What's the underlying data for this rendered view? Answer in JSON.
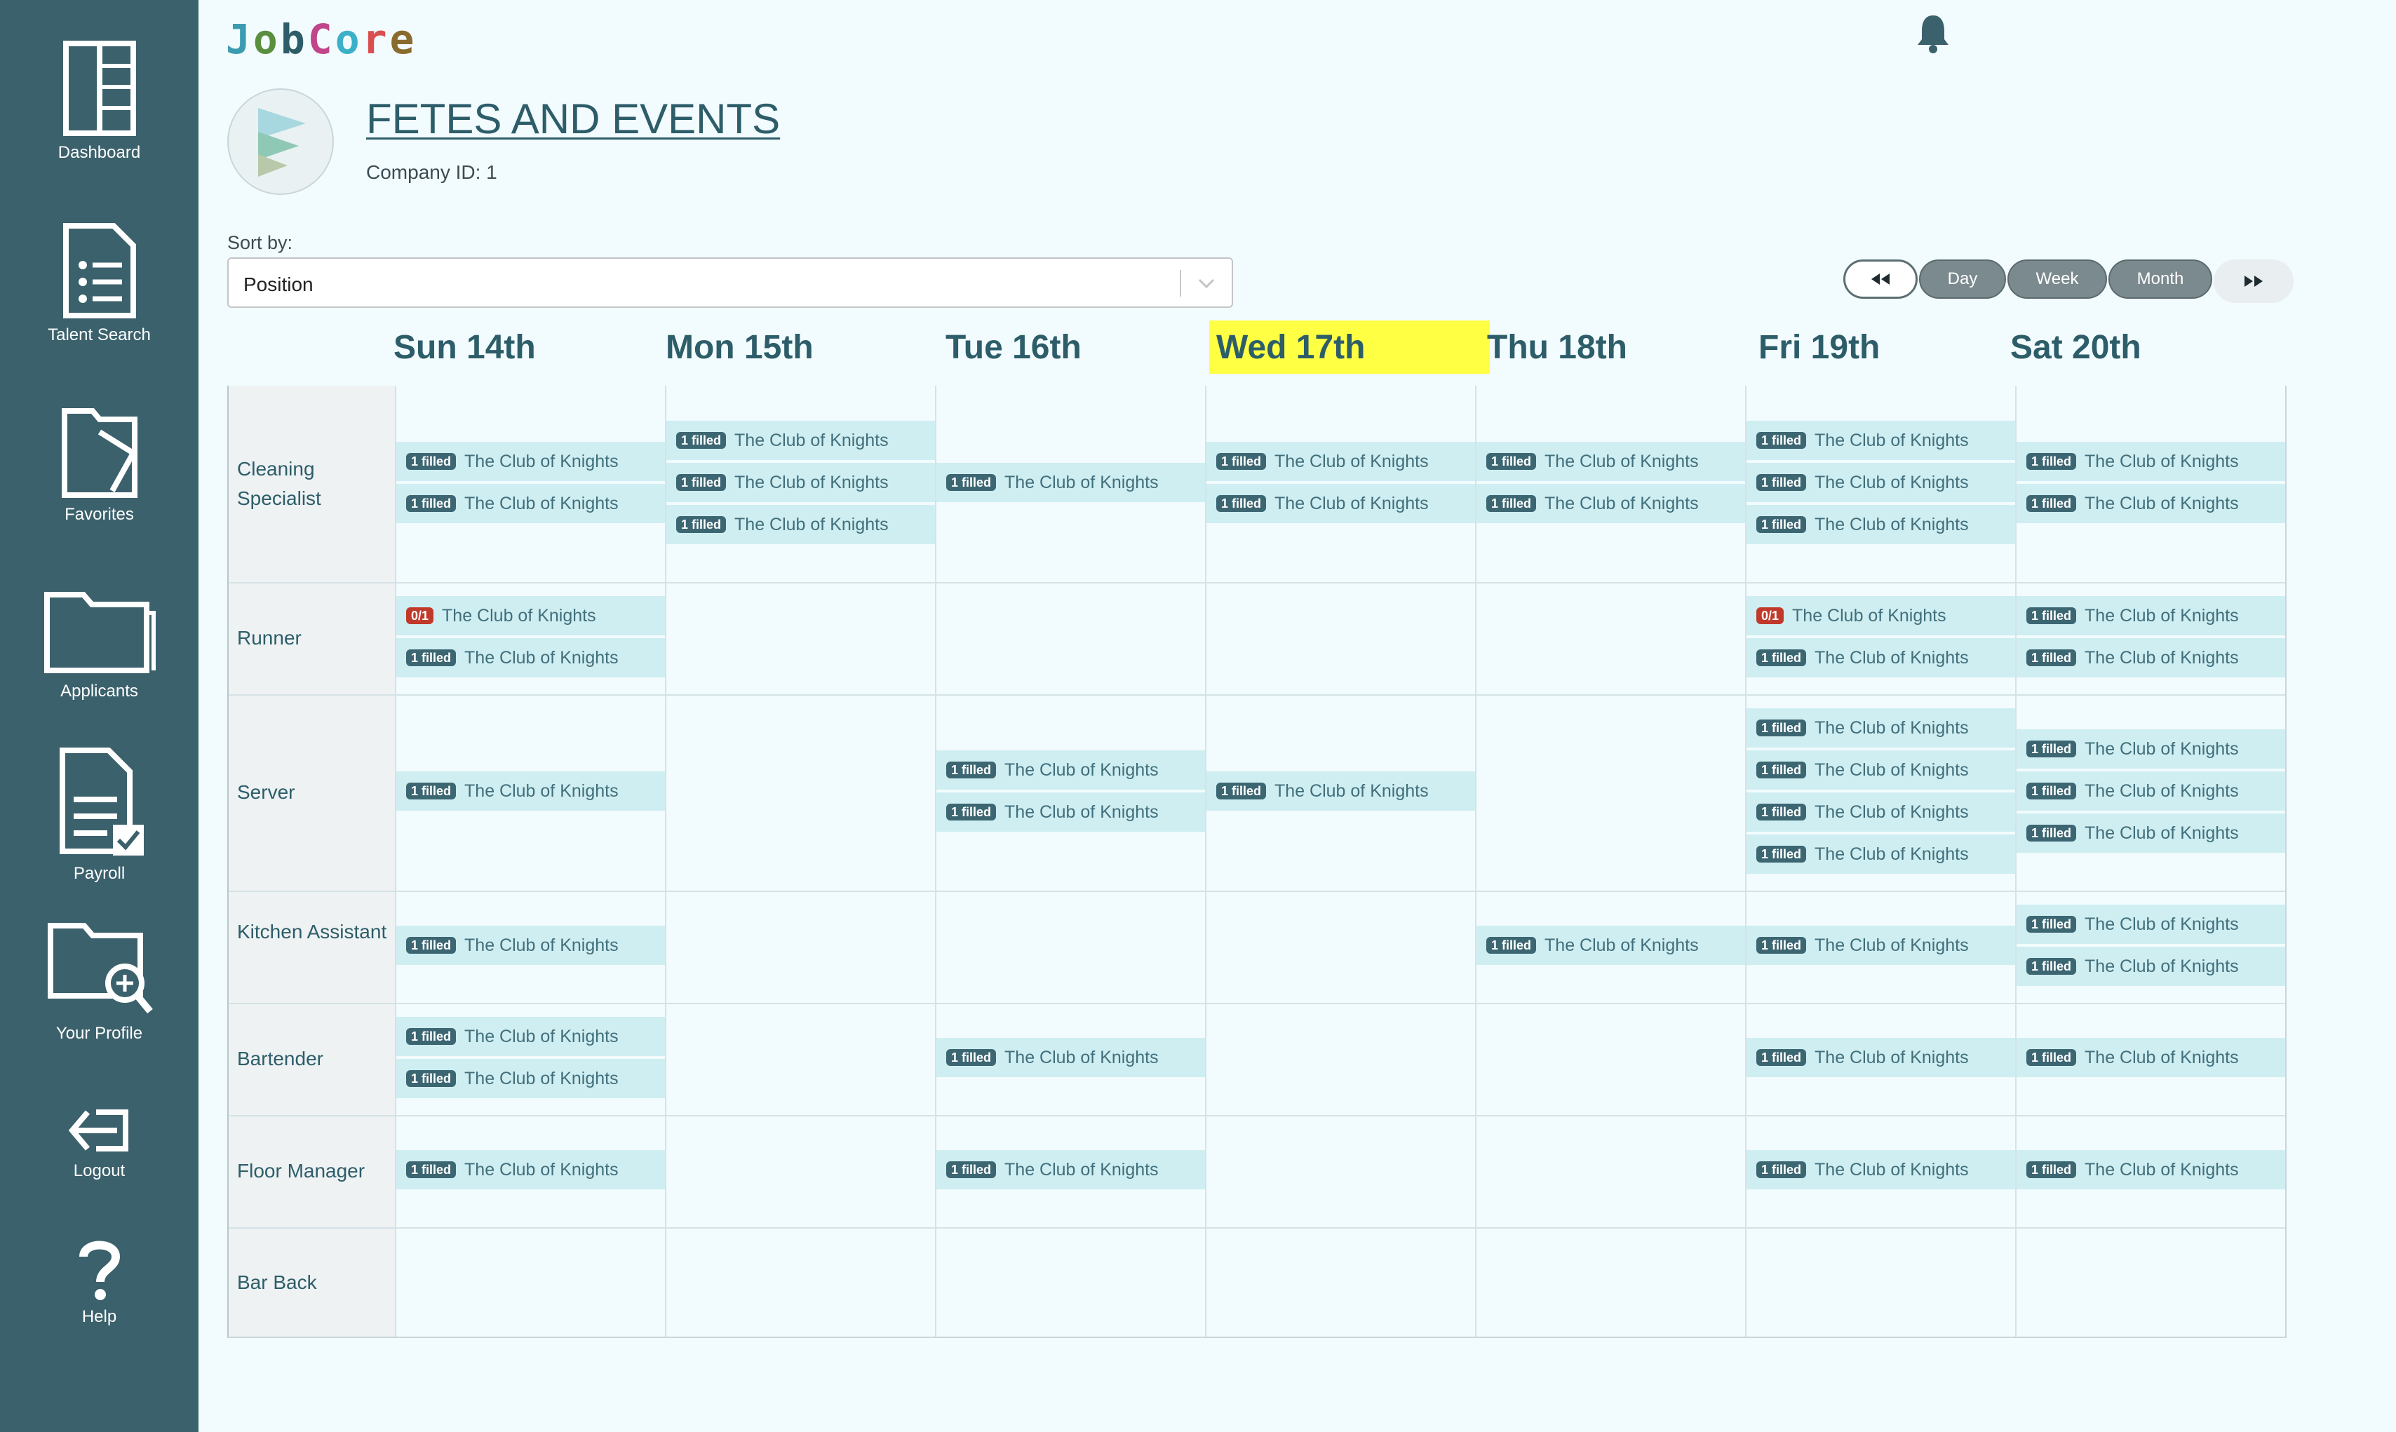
{
  "sidebar": {
    "items": [
      {
        "label": "Dashboard",
        "icon": "dashboard-icon"
      },
      {
        "label": "Talent Search",
        "icon": "document-list-icon"
      },
      {
        "label": "Favorites",
        "icon": "favorites-folder-icon"
      },
      {
        "label": "Applicants",
        "icon": "folder-icon"
      },
      {
        "label": "Payroll",
        "icon": "payroll-document-icon"
      },
      {
        "label": "Your Profile",
        "icon": "folder-search-icon"
      },
      {
        "label": "Logout",
        "icon": "logout-arrow-icon"
      },
      {
        "label": "Help",
        "icon": "question-mark-icon"
      }
    ]
  },
  "header": {
    "brand": "JobCore",
    "notification_icon": "bell-icon"
  },
  "company": {
    "name": "FETES AND EVENTS",
    "id_text": "Company ID: 1"
  },
  "sort": {
    "label": "Sort by:",
    "value": "Position"
  },
  "calendar_nav": {
    "prev_icon": "rewind-icon",
    "next_icon": "fast-forward-icon",
    "views": [
      "Day",
      "Week",
      "Month"
    ]
  },
  "calendar": {
    "today_color": "#ffff44",
    "days": [
      {
        "label": "Sun 14th"
      },
      {
        "label": "Mon 15th"
      },
      {
        "label": "Tue 16th"
      },
      {
        "label": "Wed 17th",
        "today": true
      },
      {
        "label": "Thu 18th"
      },
      {
        "label": "Fri 19th"
      },
      {
        "label": "Sat 20th"
      }
    ],
    "positions": [
      {
        "label": "Cleaning Specialist",
        "shifts": [
          [
            {
              "badge": "1 filled",
              "title": "The Club of Knights"
            },
            {
              "badge": "1 filled",
              "title": "The Club of Knights"
            }
          ],
          [
            {
              "badge": "1 filled",
              "title": "The Club of Knights"
            },
            {
              "badge": "1 filled",
              "title": "The Club of Knights"
            },
            {
              "badge": "1 filled",
              "title": "The Club of Knights"
            }
          ],
          [
            {
              "badge": "1 filled",
              "title": "The Club of Knights"
            }
          ],
          [
            {
              "badge": "1 filled",
              "title": "The Club of Knights"
            },
            {
              "badge": "1 filled",
              "title": "The Club of Knights"
            }
          ],
          [
            {
              "badge": "1 filled",
              "title": "The Club of Knights"
            },
            {
              "badge": "1 filled",
              "title": "The Club of Knights"
            }
          ],
          [
            {
              "badge": "1 filled",
              "title": "The Club of Knights"
            },
            {
              "badge": "1 filled",
              "title": "The Club of Knights"
            },
            {
              "badge": "1 filled",
              "title": "The Club of Knights"
            }
          ],
          [
            {
              "badge": "1 filled",
              "title": "The Club of Knights"
            },
            {
              "badge": "1 filled",
              "title": "The Club of Knights"
            }
          ]
        ]
      },
      {
        "label": "Runner",
        "shifts": [
          [
            {
              "badge": "0/1",
              "title": "The Club of Knights",
              "warn": true
            },
            {
              "badge": "1 filled",
              "title": "The Club of Knights"
            }
          ],
          [],
          [],
          [],
          [],
          [
            {
              "badge": "0/1",
              "title": "The Club of Knights",
              "warn": true
            },
            {
              "badge": "1 filled",
              "title": "The Club of Knights"
            }
          ],
          [
            {
              "badge": "1 filled",
              "title": "The Club of Knights"
            },
            {
              "badge": "1 filled",
              "title": "The Club of Knights"
            }
          ]
        ]
      },
      {
        "label": "Server",
        "shifts": [
          [
            {
              "badge": "1 filled",
              "title": "The Club of Knights"
            }
          ],
          [],
          [
            {
              "badge": "1 filled",
              "title": "The Club of Knights"
            },
            {
              "badge": "1 filled",
              "title": "The Club of Knights"
            }
          ],
          [
            {
              "badge": "1 filled",
              "title": "The Club of Knights"
            }
          ],
          [],
          [
            {
              "badge": "1 filled",
              "title": "The Club of Knights"
            },
            {
              "badge": "1 filled",
              "title": "The Club of Knights"
            },
            {
              "badge": "1 filled",
              "title": "The Club of Knights"
            },
            {
              "badge": "1 filled",
              "title": "The Club of Knights"
            }
          ],
          [
            {
              "badge": "1 filled",
              "title": "The Club of Knights"
            },
            {
              "badge": "1 filled",
              "title": "The Club of Knights"
            },
            {
              "badge": "1 filled",
              "title": "The Club of Knights"
            }
          ]
        ]
      },
      {
        "label": "Kitchen Assistant",
        "shifts": [
          [
            {
              "badge": "1 filled",
              "title": "The Club of Knights"
            }
          ],
          [],
          [],
          [],
          [
            {
              "badge": "1 filled",
              "title": "The Club of Knights"
            }
          ],
          [
            {
              "badge": "1 filled",
              "title": "The Club of Knights"
            }
          ],
          [
            {
              "badge": "1 filled",
              "title": "The Club of Knights"
            },
            {
              "badge": "1 filled",
              "title": "The Club of Knights"
            }
          ]
        ]
      },
      {
        "label": "Bartender",
        "shifts": [
          [
            {
              "badge": "1 filled",
              "title": "The Club of Knights"
            },
            {
              "badge": "1 filled",
              "title": "The Club of Knights"
            }
          ],
          [],
          [
            {
              "badge": "1 filled",
              "title": "The Club of Knights"
            }
          ],
          [],
          [],
          [
            {
              "badge": "1 filled",
              "title": "The Club of Knights"
            }
          ],
          [
            {
              "badge": "1 filled",
              "title": "The Club of Knights"
            }
          ]
        ]
      },
      {
        "label": "Floor Manager",
        "shifts": [
          [
            {
              "badge": "1 filled",
              "title": "The Club of Knights"
            }
          ],
          [],
          [
            {
              "badge": "1 filled",
              "title": "The Club of Knights"
            }
          ],
          [],
          [],
          [
            {
              "badge": "1 filled",
              "title": "The Club of Knights"
            }
          ],
          [
            {
              "badge": "1 filled",
              "title": "The Club of Knights"
            }
          ]
        ]
      },
      {
        "label": "Bar Back",
        "shifts": [
          [],
          [],
          [],
          [],
          [],
          [],
          []
        ]
      }
    ]
  }
}
